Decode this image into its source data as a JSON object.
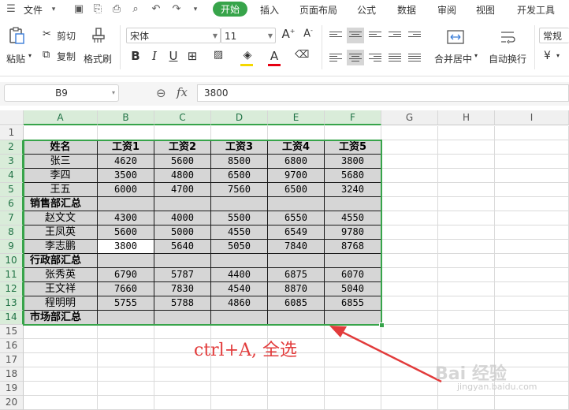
{
  "menu": {
    "file": "文件",
    "tabs": [
      "开始",
      "插入",
      "页面布局",
      "公式",
      "数据",
      "审阅",
      "视图",
      "开发工具"
    ]
  },
  "ribbon": {
    "paste": "粘贴",
    "cut": "剪切",
    "copy": "复制",
    "format_painter": "格式刷",
    "font_name": "宋体",
    "font_size": "11",
    "merge_center": "合并居中",
    "wrap_text": "自动换行",
    "number_format": "常规",
    "currency": "¥"
  },
  "formula_bar": {
    "cell_ref": "B9",
    "fx": "fx",
    "value": "3800"
  },
  "grid": {
    "columns": [
      "A",
      "B",
      "C",
      "D",
      "E",
      "F",
      "G",
      "H",
      "I"
    ],
    "rows": [
      "1",
      "2",
      "3",
      "4",
      "5",
      "6",
      "7",
      "8",
      "9",
      "10",
      "11",
      "12",
      "13",
      "14",
      "15",
      "16",
      "17",
      "18",
      "19",
      "20"
    ],
    "cells": {
      "r2": [
        "姓名",
        "工资1",
        "工资2",
        "工资3",
        "工资4",
        "工资5"
      ],
      "r3": [
        "张三",
        "4620",
        "5600",
        "8500",
        "6800",
        "3800"
      ],
      "r4": [
        "李四",
        "3500",
        "4800",
        "6500",
        "9700",
        "5680"
      ],
      "r5": [
        "王五",
        "6000",
        "4700",
        "7560",
        "6500",
        "3240"
      ],
      "r6": [
        "销售部汇总",
        "",
        "",
        "",
        "",
        ""
      ],
      "r7": [
        "赵文文",
        "4300",
        "4000",
        "5500",
        "6550",
        "4550"
      ],
      "r8": [
        "王凤英",
        "5600",
        "5000",
        "4550",
        "6549",
        "9780"
      ],
      "r9": [
        "李志鹏",
        "3800",
        "5640",
        "5050",
        "7840",
        "8768"
      ],
      "r10": [
        "行政部汇总",
        "",
        "",
        "",
        "",
        ""
      ],
      "r11": [
        "张秀英",
        "6790",
        "5787",
        "4400",
        "6875",
        "6070"
      ],
      "r12": [
        "王文祥",
        "7660",
        "7830",
        "4540",
        "8870",
        "5040"
      ],
      "r13": [
        "程明明",
        "5755",
        "5788",
        "4860",
        "6085",
        "6855"
      ],
      "r14": [
        "市场部汇总",
        "",
        "",
        "",
        "",
        ""
      ]
    }
  },
  "annotation": "ctrl+A, 全选",
  "watermark": {
    "main": "Bai 经验",
    "sub": "jingyan.baidu.com"
  },
  "colors": {
    "accent_green": "#37a44a",
    "selection_gray": "#d6d6d6",
    "annotation_red": "#e23b3b"
  }
}
